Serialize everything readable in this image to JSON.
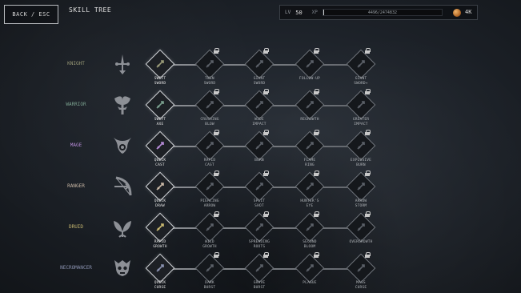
{
  "header": {
    "back_label": "BACK / ESC",
    "title": "SKILL TREE",
    "level_label": "LV",
    "level_value": "50",
    "xp_label": "XP",
    "xp_text": "4496/2474832",
    "xp_progress": 0.002,
    "currency_value": "4K",
    "currency_icon": "coin-icon"
  },
  "colors": {
    "knight": "#9a9b78",
    "warrior": "#7aa08e",
    "mage": "#b58ad6",
    "ranger": "#c9b8a6",
    "druid": "#c8b870",
    "necromancer": "#8a92b0"
  },
  "classes": [
    {
      "name": "KNIGHT",
      "icon": "sword-emblem-icon",
      "skills": [
        {
          "label": "SWIFT\nSWORD",
          "unlocked": true,
          "icon": "swift-sword-icon"
        },
        {
          "label": "TWIN\nSWORD",
          "unlocked": false,
          "icon": "twin-sword-icon"
        },
        {
          "label": "GIANT\nSWORD",
          "unlocked": false,
          "icon": "giant-sword-icon"
        },
        {
          "label": "FOLLOW-UP",
          "unlocked": false,
          "icon": "follow-up-icon"
        },
        {
          "label": "GIANT\nSWORD+",
          "unlocked": false,
          "icon": "giant-sword-plus-icon"
        }
      ]
    },
    {
      "name": "WARRIOR",
      "icon": "axe-emblem-icon",
      "skills": [
        {
          "label": "SWIFT\nAXE",
          "unlocked": true,
          "icon": "swift-axe-icon"
        },
        {
          "label": "CRUSHING\nBLOW",
          "unlocked": false,
          "icon": "crushing-blow-icon"
        },
        {
          "label": "WIDE\nIMPACT",
          "unlocked": false,
          "icon": "wide-impact-icon"
        },
        {
          "label": "REGROWTH",
          "unlocked": false,
          "icon": "regrowth-icon"
        },
        {
          "label": "GREATER\nIMPACT",
          "unlocked": false,
          "icon": "greater-impact-icon"
        }
      ]
    },
    {
      "name": "MAGE",
      "icon": "mage-emblem-icon",
      "skills": [
        {
          "label": "QUICK\nCAST",
          "unlocked": true,
          "icon": "quick-cast-icon"
        },
        {
          "label": "RAPID\nCAST",
          "unlocked": false,
          "icon": "rapid-cast-icon"
        },
        {
          "label": "BURN",
          "unlocked": false,
          "icon": "burn-icon"
        },
        {
          "label": "FLAME\nRING",
          "unlocked": false,
          "icon": "flame-ring-icon"
        },
        {
          "label": "EXPLOSIVE\nBURN",
          "unlocked": false,
          "icon": "explosive-burn-icon"
        }
      ]
    },
    {
      "name": "RANGER",
      "icon": "bow-emblem-icon",
      "skills": [
        {
          "label": "QUICK\nDRAW",
          "unlocked": true,
          "icon": "quick-draw-icon"
        },
        {
          "label": "PIERCING\nARROW",
          "unlocked": false,
          "icon": "piercing-arrow-icon"
        },
        {
          "label": "SPLIT\nSHOT",
          "unlocked": false,
          "icon": "split-shot-icon"
        },
        {
          "label": "HUNTER'S\nEYE",
          "unlocked": false,
          "icon": "hunters-eye-icon"
        },
        {
          "label": "ARROW\nSTORM",
          "unlocked": false,
          "icon": "arrow-storm-icon"
        }
      ]
    },
    {
      "name": "DRUID",
      "icon": "leaf-emblem-icon",
      "skills": [
        {
          "label": "RAPID\nGROWTH",
          "unlocked": true,
          "icon": "rapid-growth-icon"
        },
        {
          "label": "WILD\nGROWTH",
          "unlocked": false,
          "icon": "wild-growth-icon"
        },
        {
          "label": "SPREADING\nROOTS",
          "unlocked": false,
          "icon": "spreading-roots-icon"
        },
        {
          "label": "SECOND\nBLOOM",
          "unlocked": false,
          "icon": "second-bloom-icon"
        },
        {
          "label": "OVERGROWTH",
          "unlocked": false,
          "icon": "overgrowth-icon"
        }
      ]
    },
    {
      "name": "NECROMANCER",
      "icon": "skull-emblem-icon",
      "skills": [
        {
          "label": "QUICK\nCURSE",
          "unlocked": true,
          "icon": "quick-curse-icon"
        },
        {
          "label": "DARK\nBURST",
          "unlocked": false,
          "icon": "dark-burst-icon"
        },
        {
          "label": "GRAVE\nBURST",
          "unlocked": false,
          "icon": "grave-burst-icon"
        },
        {
          "label": "PLAGUE",
          "unlocked": false,
          "icon": "plague-icon"
        },
        {
          "label": "MASS\nCURSE",
          "unlocked": false,
          "icon": "mass-curse-icon"
        }
      ]
    }
  ]
}
